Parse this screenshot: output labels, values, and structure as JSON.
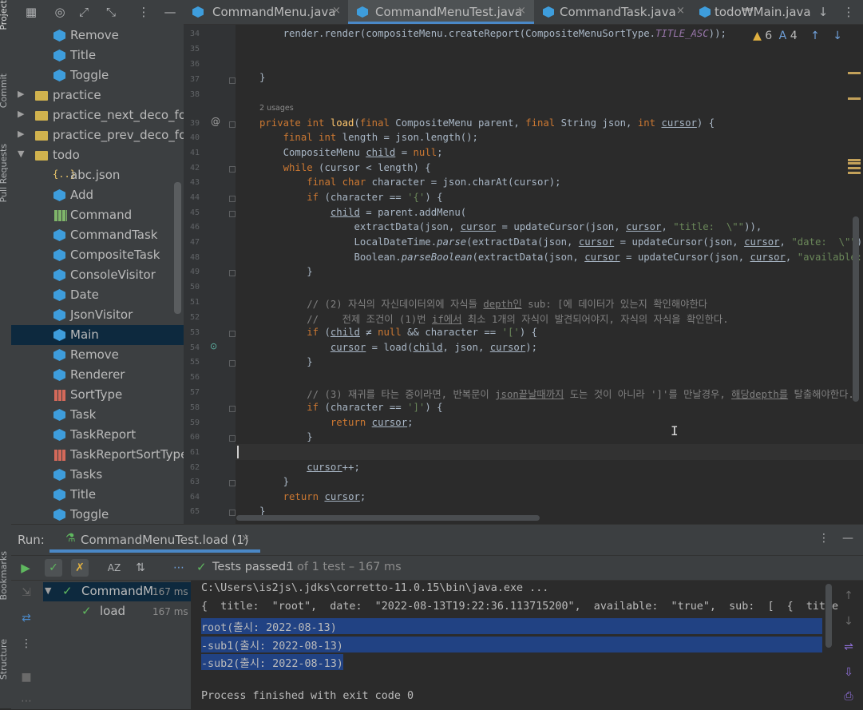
{
  "side_labels": {
    "project": "Project",
    "commit": "Commit",
    "pull_requests": "Pull Requests",
    "bookmarks": "Bookmarks",
    "structure": "Structure"
  },
  "tree": [
    {
      "label": "Remove",
      "type": "class",
      "depth": 2
    },
    {
      "label": "Title",
      "type": "class",
      "depth": 2
    },
    {
      "label": "Toggle",
      "type": "class",
      "depth": 2
    },
    {
      "label": "practice",
      "type": "folder",
      "depth": 0,
      "arrow": "▶"
    },
    {
      "label": "practice_next_deco_for_a",
      "type": "folder",
      "depth": 0,
      "arrow": "▶"
    },
    {
      "label": "practice_prev_deco_for_s",
      "type": "folder",
      "depth": 0,
      "arrow": "▶"
    },
    {
      "label": "todo",
      "type": "folder",
      "depth": 0,
      "arrow": "▼"
    },
    {
      "label": "abc.json",
      "type": "json",
      "depth": 1
    },
    {
      "label": "Add",
      "type": "class",
      "depth": 1
    },
    {
      "label": "Command",
      "type": "interface",
      "depth": 1
    },
    {
      "label": "CommandTask",
      "type": "class",
      "depth": 1
    },
    {
      "label": "CompositeTask",
      "type": "class",
      "depth": 1
    },
    {
      "label": "ConsoleVisitor",
      "type": "class",
      "depth": 1
    },
    {
      "label": "Date",
      "type": "class",
      "depth": 1
    },
    {
      "label": "JsonVisitor",
      "type": "class",
      "depth": 1
    },
    {
      "label": "Main",
      "type": "class",
      "depth": 1,
      "selected": true
    },
    {
      "label": "Remove",
      "type": "class",
      "depth": 1
    },
    {
      "label": "Renderer",
      "type": "class",
      "depth": 1
    },
    {
      "label": "SortType",
      "type": "enum",
      "depth": 1
    },
    {
      "label": "Task",
      "type": "class",
      "depth": 1
    },
    {
      "label": "TaskReport",
      "type": "class",
      "depth": 1
    },
    {
      "label": "TaskReportSortType",
      "type": "enum",
      "depth": 1
    },
    {
      "label": "Tasks",
      "type": "class",
      "depth": 1
    },
    {
      "label": "Title",
      "type": "class",
      "depth": 1
    },
    {
      "label": "Toggle",
      "type": "class",
      "depth": 1
    }
  ],
  "tabs": [
    {
      "label": "CommandMenu.java",
      "active": false
    },
    {
      "label": "CommandMenuTest.java",
      "active": true
    },
    {
      "label": "CommandTask.java",
      "active": false
    },
    {
      "label": "todo₩Main.java",
      "active": false
    }
  ],
  "inspections": {
    "warnings": "6",
    "typos": "4"
  },
  "code": {
    "usages_hint": "2 usages",
    "line_numbers": [
      "34",
      "35",
      "36",
      "37",
      "38",
      "39",
      "40",
      "41",
      "42",
      "43",
      "44",
      "45",
      "46",
      "47",
      "48",
      "49",
      "50",
      "51",
      "52",
      "53",
      "54",
      "55",
      "56",
      "57",
      "58",
      "59",
      "60",
      "61",
      "62",
      "63",
      "64",
      "65"
    ]
  },
  "run": {
    "label": "Run:",
    "config": "CommandMenuTest.load (1)",
    "tests_passed_label": "Tests passed:",
    "tests_passed_count": "1",
    "tests_total": "of 1 test – 167 ms",
    "tree": [
      {
        "label": "CommandM",
        "time": "167 ms"
      },
      {
        "label": "load",
        "time": "167 ms"
      }
    ],
    "console": [
      {
        "text": "C:\\Users\\is2js\\.jdks\\corretto-11.0.15\\bin\\java.exe ...",
        "selected": false
      },
      {
        "text": "{  title:  \"root\",  date:  \"2022-08-13T19:22:36.113715200\",  available:  \"true\",  sub:  [  {  title",
        "selected": false
      },
      {
        "text": "root(출시: 2022-08-13)",
        "selected": true,
        "full": true
      },
      {
        "text": "-sub1(출시: 2022-08-13)",
        "selected": true,
        "full": true
      },
      {
        "text": "-sub2(출시: 2022-08-13)",
        "selected": true,
        "full": false
      },
      {
        "text": "",
        "selected": false
      },
      {
        "text": "Process finished with exit code 0",
        "selected": false
      }
    ]
  }
}
